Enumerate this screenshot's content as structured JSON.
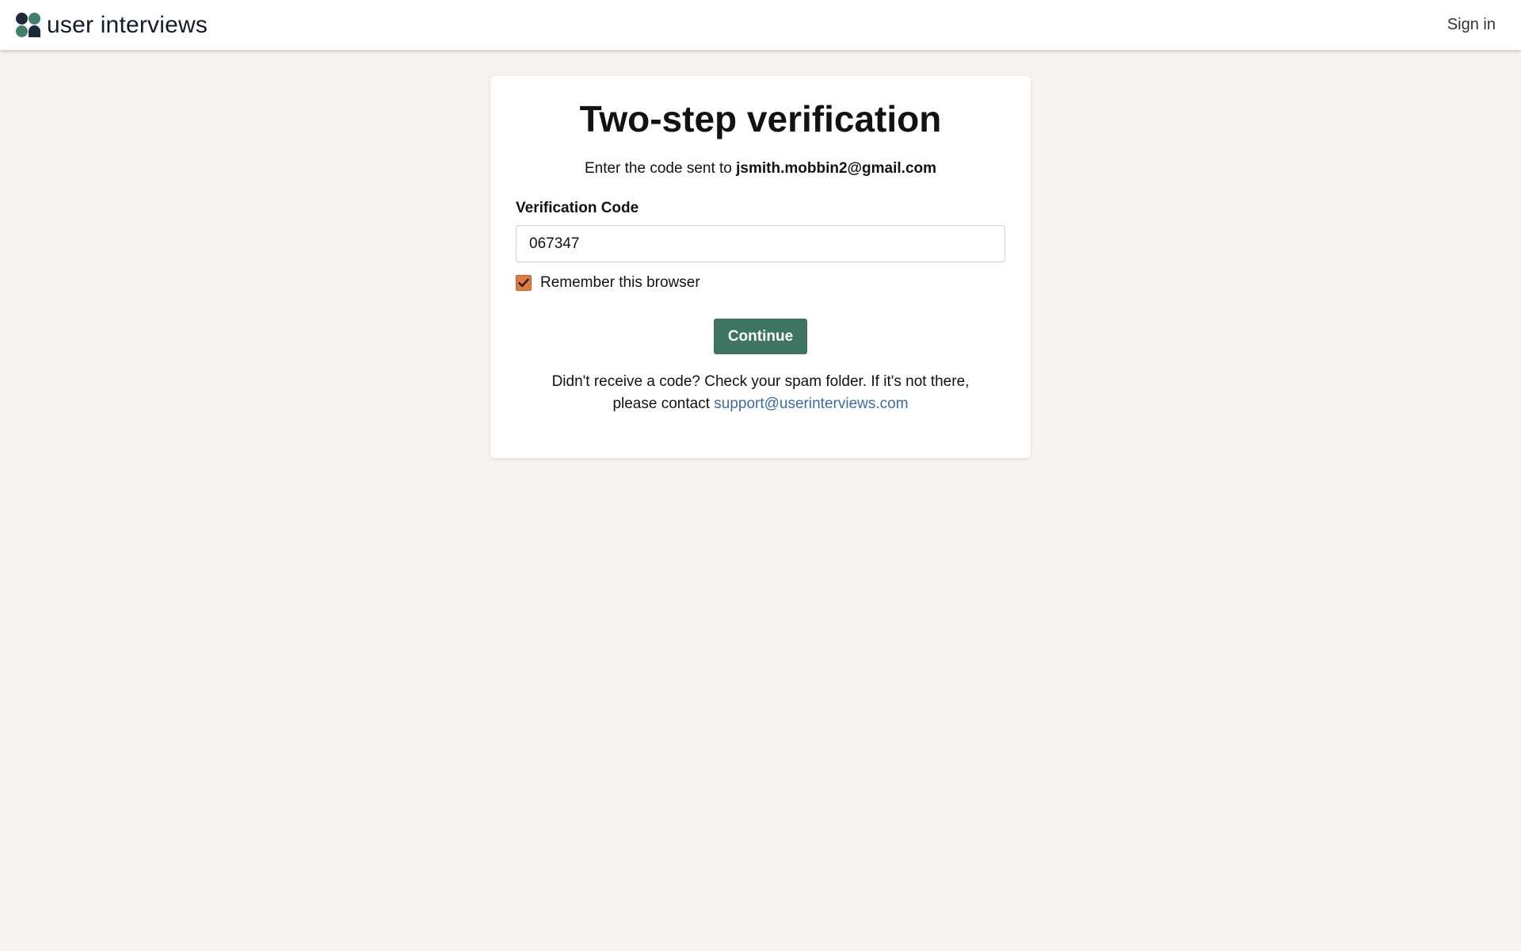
{
  "header": {
    "logo_text": "user interviews",
    "signin_label": "Sign in"
  },
  "card": {
    "title": "Two-step verification",
    "subtitle_prefix": "Enter the code sent to",
    "email": "jsmith.mobbin2@gmail.com",
    "field_label": "Verification Code",
    "code_value": "067347",
    "remember_label": "Remember this browser",
    "remember_checked": true,
    "continue_label": "Continue",
    "help_line1": "Didn't receive a code? Check your spam folder. If it's not there,",
    "help_line2_prefix": "please contact",
    "support_email": "support@userinterviews.com"
  },
  "colors": {
    "accent_green": "#3d7562",
    "checkbox_orange": "#e07b3c",
    "link_blue": "#3a6aa8",
    "page_background": "#f7f3f1"
  },
  "icons": {
    "logo": "user-interviews-logo-icon",
    "checkmark": "checkmark-icon"
  }
}
